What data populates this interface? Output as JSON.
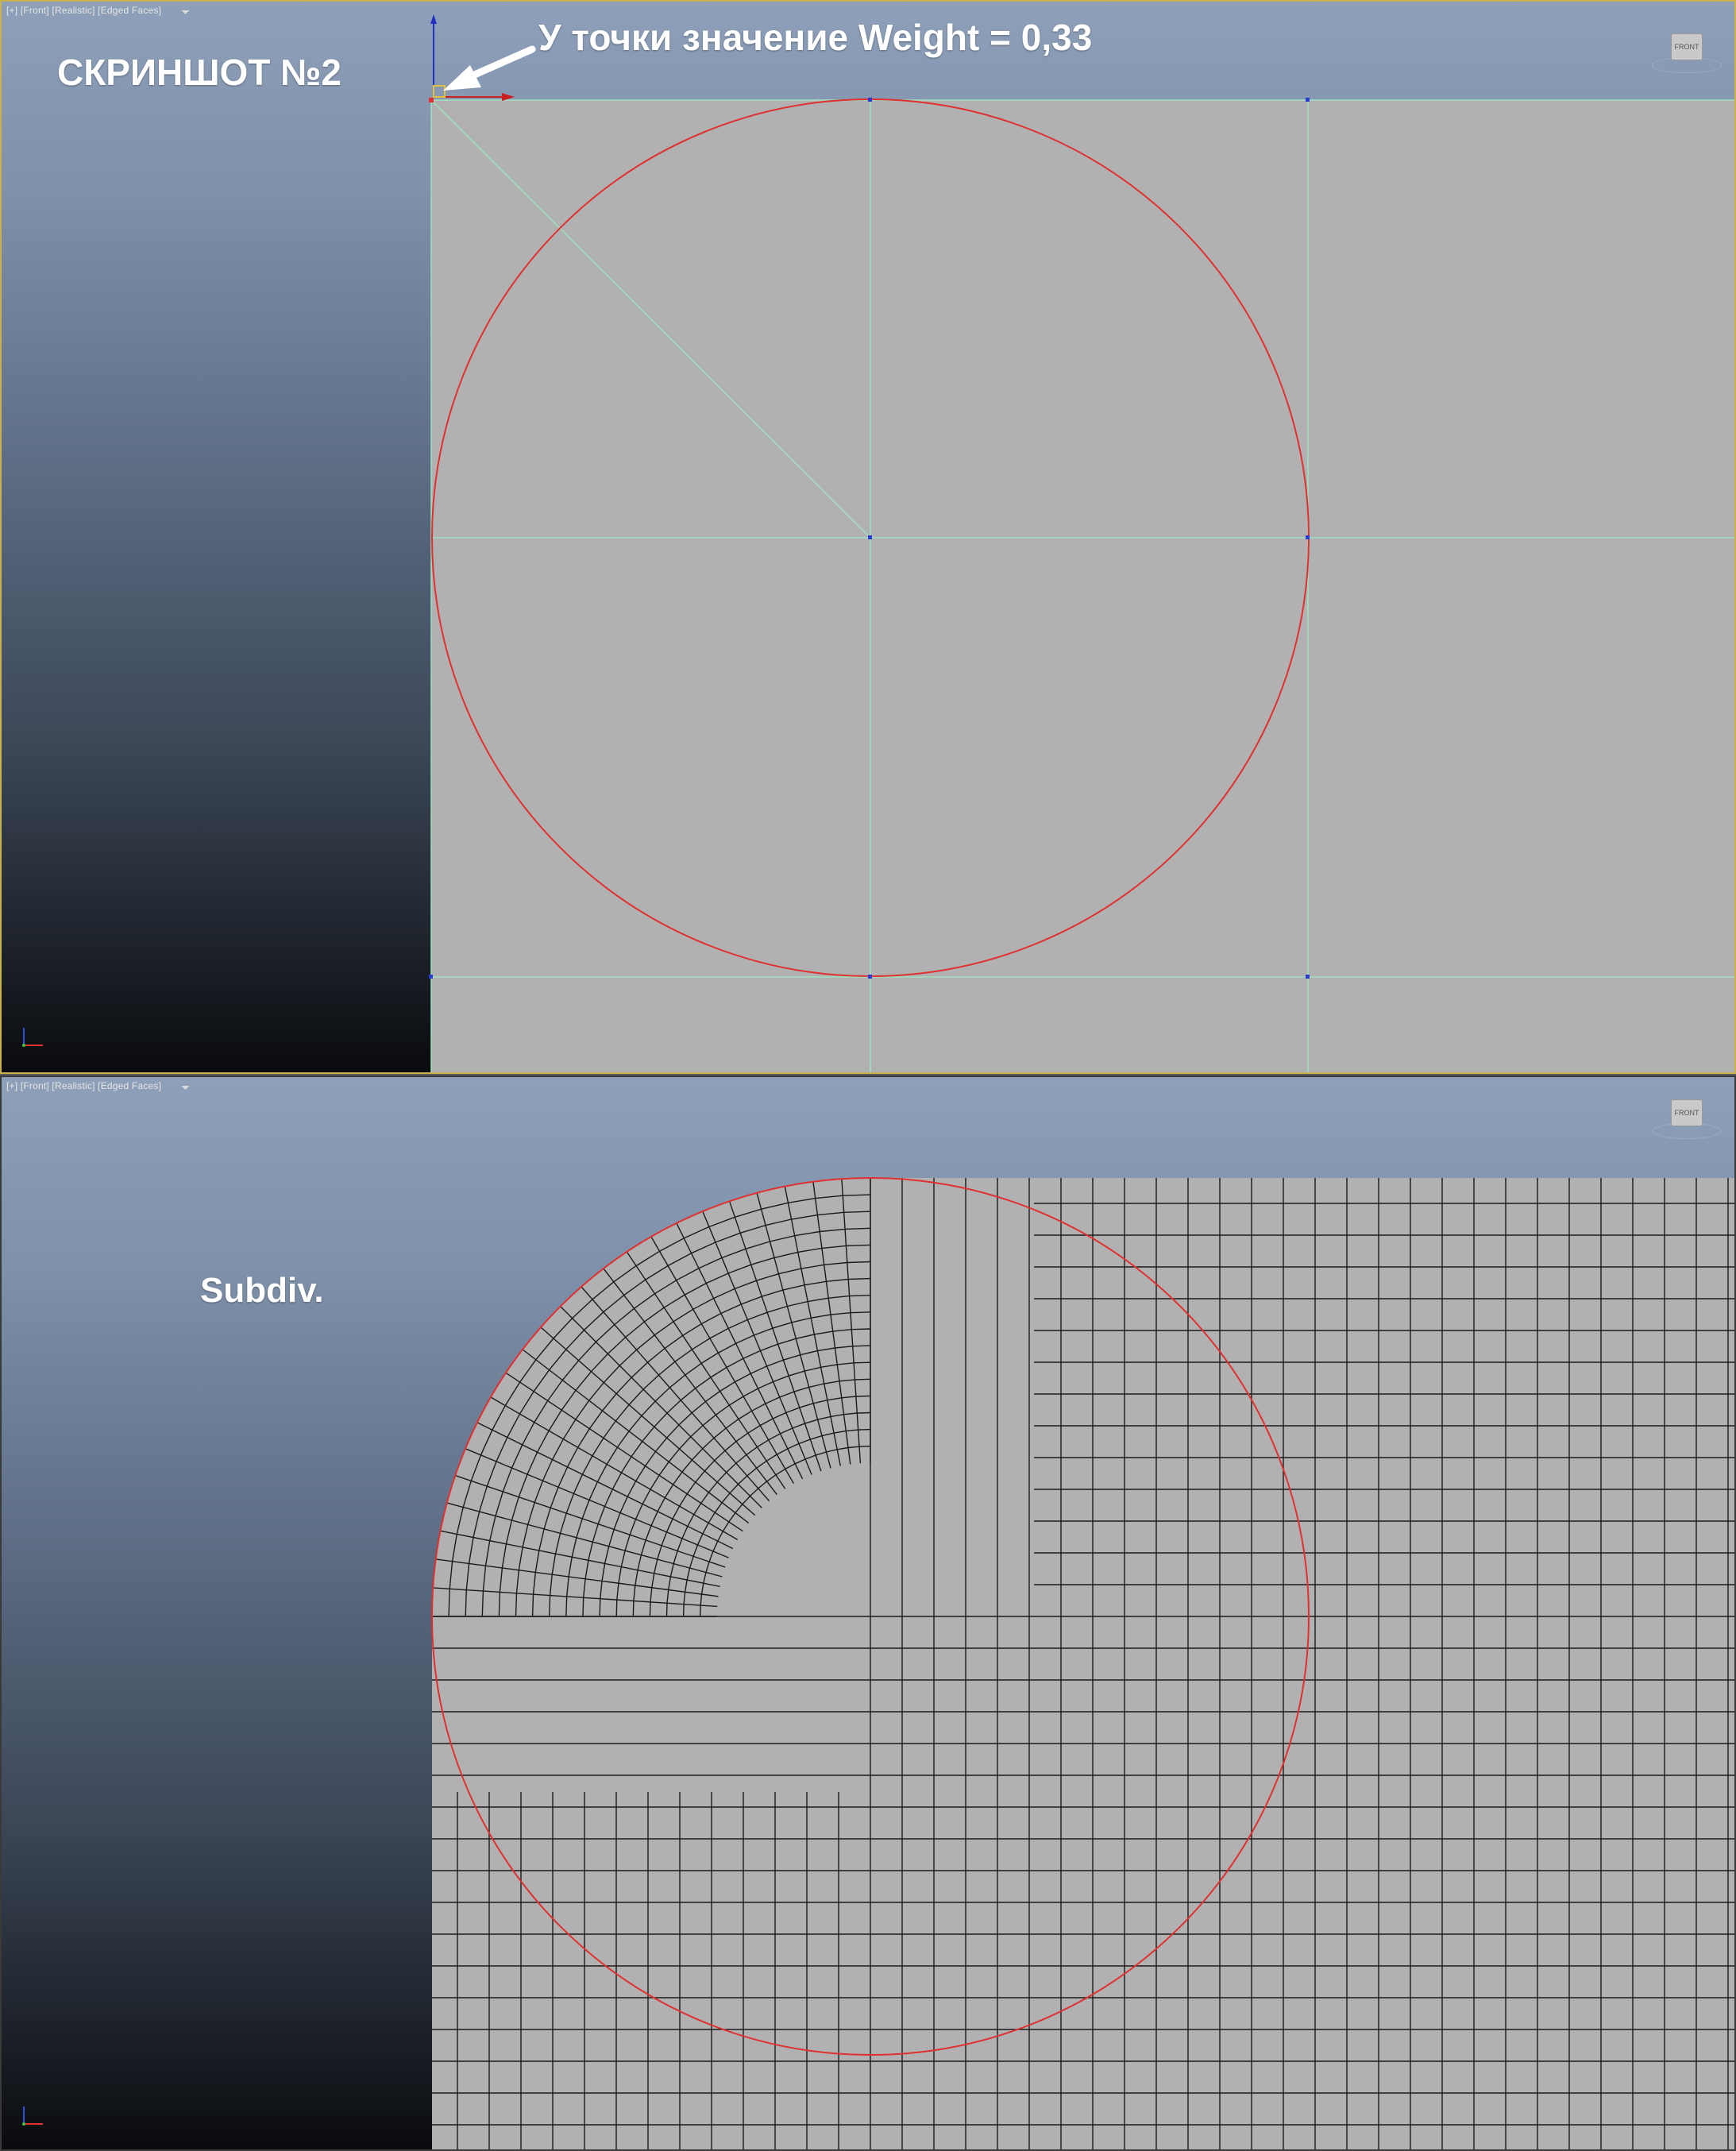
{
  "top_viewport": {
    "label": "[+] [Front] [Realistic] [Edged Faces]",
    "overlay_title": "СКРИНШОТ №2",
    "annotation": "У точки значение Weight = 0,33",
    "viewcube_label": "FRONT"
  },
  "bottom_viewport": {
    "label": "[+] [Front] [Realistic] [Edged Faces]",
    "overlay_title": "Subdiv.",
    "viewcube_label": "FRONT"
  },
  "colors": {
    "plane": "#b1b1b1",
    "curve": "#e03030",
    "cage_edge": "#9fe0c0",
    "mesh_edge": "#1a1a1a",
    "vertex": "#2a3ad0"
  }
}
